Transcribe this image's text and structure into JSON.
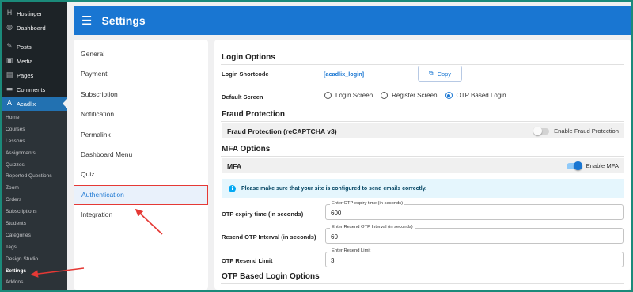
{
  "wp_sidebar": {
    "top_items": [
      {
        "label": "Hostinger",
        "icon": "hostinger-icon",
        "glyph": "H"
      },
      {
        "label": "Dashboard",
        "icon": "dashboard-icon",
        "glyph": "◍"
      }
    ],
    "items": [
      {
        "label": "Posts",
        "icon": "pin-icon",
        "glyph": "✎"
      },
      {
        "label": "Media",
        "icon": "media-icon",
        "glyph": "▣"
      },
      {
        "label": "Pages",
        "icon": "pages-icon",
        "glyph": "▤"
      },
      {
        "label": "Comments",
        "icon": "comments-icon",
        "glyph": "▬"
      }
    ],
    "active_item": {
      "label": "Acadlix",
      "icon": "acadlix-icon",
      "glyph": "A"
    },
    "submenu": [
      "Home",
      "Courses",
      "Lessons",
      "Assignments",
      "Quizzes",
      "Reported Questions",
      "Zoom",
      "Orders",
      "Subscriptions",
      "Students",
      "Categories",
      "Tags",
      "Design Studio",
      "Settings",
      "Addons"
    ],
    "current_submenu": "Settings"
  },
  "header": {
    "title": "Settings",
    "menu_icon": "menu-icon"
  },
  "settings_nav": {
    "items": [
      "General",
      "Payment",
      "Subscription",
      "Notification",
      "Permalink",
      "Dashboard Menu",
      "Quiz",
      "Authentication",
      "Integration"
    ],
    "active": "Authentication"
  },
  "login_options": {
    "title": "Login Options",
    "shortcode_label": "Login Shortcode",
    "shortcode_value": "[acadlix_login]",
    "copy_label": "Copy",
    "default_screen_label": "Default Screen",
    "screens": [
      {
        "label": "Login Screen",
        "selected": false
      },
      {
        "label": "Register Screen",
        "selected": false
      },
      {
        "label": "OTP Based Login",
        "selected": true
      }
    ]
  },
  "fraud": {
    "title": "Fraud Protection",
    "bar_title": "Fraud Protection (reCAPTCHA v3)",
    "toggle_label": "Enable Fraud Protection",
    "enabled": false
  },
  "mfa": {
    "title": "MFA Options",
    "bar_title": "MFA",
    "toggle_label": "Enable MFA",
    "enabled": true,
    "info_text": "Please make sure that your site is configured to send emails correctly.",
    "fields": [
      {
        "label": "OTP expiry time (in seconds)",
        "field_label": "Enter OTP expiry time (in seconds)",
        "value": "600"
      },
      {
        "label": "Resend OTP Interval (in seconds)",
        "field_label": "Enter Resend OTP Interval (in seconds)",
        "value": "60"
      },
      {
        "label": "OTP Resend Limit",
        "field_label": "Enter Resend Limit",
        "value": "3"
      }
    ]
  },
  "otp_login": {
    "title": "OTP Based Login Options"
  },
  "colors": {
    "primary": "#1976d2",
    "highlight": "#e53935",
    "sidebar": "#1d2327"
  }
}
